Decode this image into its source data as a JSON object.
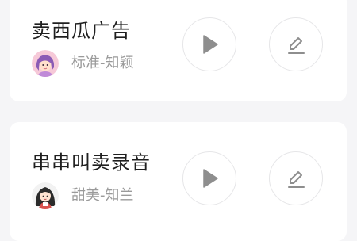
{
  "items": [
    {
      "title": "卖西瓜广告",
      "voice": "标准-知颖",
      "avatar": "female-avatar-icon"
    },
    {
      "title": "串串叫卖录音",
      "voice": "甜美-知兰",
      "avatar": "girl-avatar-icon"
    }
  ],
  "colors": {
    "background": "#f5f5f7",
    "card": "#ffffff",
    "icon": "#8e8e8e",
    "title": "#1f1f1f",
    "subtitle": "#9a9a9a"
  }
}
